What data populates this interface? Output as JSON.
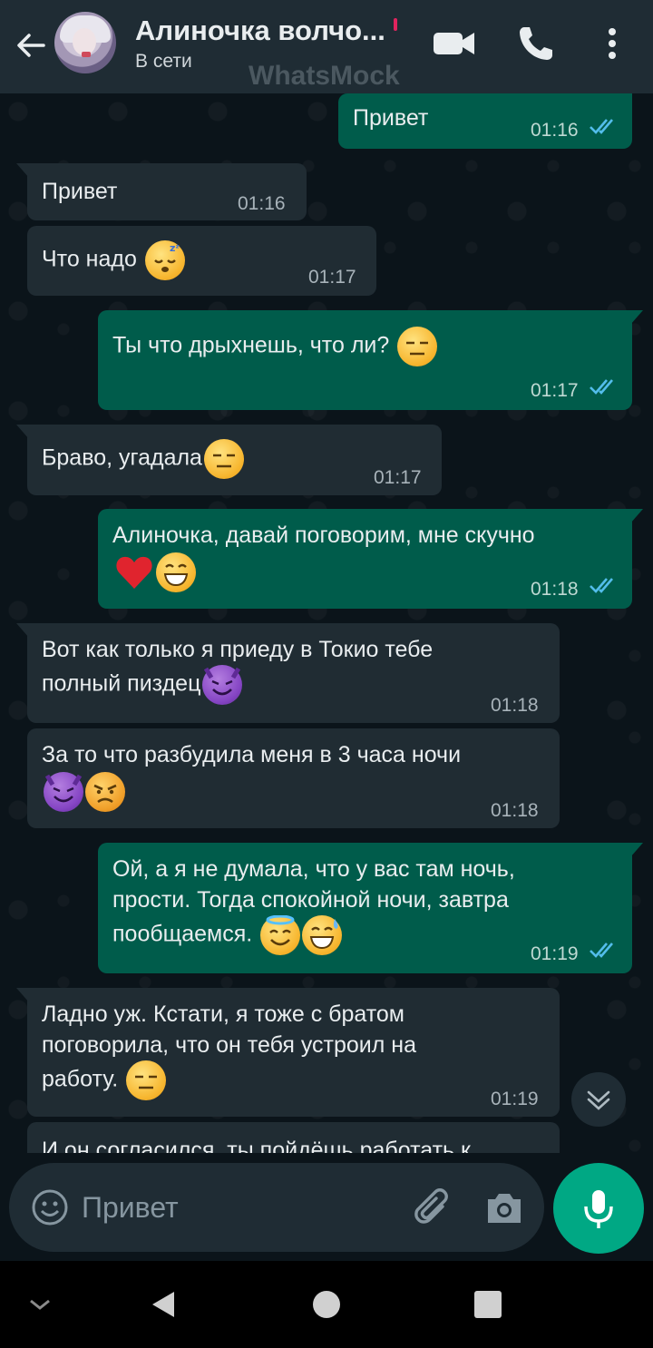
{
  "header": {
    "contact_name": "Алиночка волчо...",
    "status": "В сети",
    "watermark": "WhatsMock",
    "icons": [
      "back-arrow-icon",
      "video-call-icon",
      "phone-call-icon",
      "more-vert-icon"
    ]
  },
  "messages": [
    {
      "dir": "out",
      "text": "Привет",
      "time": "01:16",
      "read": true
    },
    {
      "dir": "in",
      "text": "Привет",
      "time": "01:16"
    },
    {
      "dir": "in",
      "text": "Что надо",
      "emoji": [
        "sleeping"
      ],
      "time": "01:17"
    },
    {
      "dir": "out",
      "text": "Ты что дрыхнешь, что ли?",
      "emoji": [
        "expressionless"
      ],
      "time": "01:17",
      "read": true
    },
    {
      "dir": "in",
      "text": "Браво, угадала",
      "emoji": [
        "expressionless"
      ],
      "time": "01:17"
    },
    {
      "dir": "out",
      "text": "Алиночка, давай поговорим, мне скучно",
      "emoji": [
        "red-heart",
        "grinning"
      ],
      "time": "01:18",
      "read": true
    },
    {
      "dir": "in",
      "text_lines": [
        "Вот как только я приеду в Токио тебе",
        "полный пиздец"
      ],
      "emoji": [
        "smiling-imp"
      ],
      "time": "01:18"
    },
    {
      "dir": "in",
      "text": "За то что разбудила меня в 3 часа ночи",
      "emoji": [
        "smiling-imp",
        "angry"
      ],
      "time": "01:18"
    },
    {
      "dir": "out",
      "text_lines": [
        "Ой, а я не думала, что у вас там ночь,",
        "прости. Тогда спокойной ночи, завтра",
        "пообщаемся."
      ],
      "emoji": [
        "halo",
        "sweat-smile"
      ],
      "time": "01:19",
      "read": true
    },
    {
      "dir": "in",
      "text_lines": [
        "Ладно уж. Кстати, я тоже с братом",
        "поговорила, что он тебя устроил на",
        "работу."
      ],
      "emoji": [
        "expressionless"
      ],
      "time": "01:19"
    },
    {
      "dir": "in",
      "text": "И он согласился, ты пойдёшь работать к",
      "partial": true
    }
  ],
  "composer": {
    "placeholder": "Привет",
    "icons": [
      "emoji-icon",
      "attach-icon",
      "camera-icon",
      "mic-icon"
    ]
  },
  "colors": {
    "background": "#0b141a",
    "header": "#1f2c34",
    "incoming_bubble": "#202c33",
    "outgoing_bubble": "#005c4b",
    "accent": "#00a884",
    "read_ticks": "#53bdeb"
  }
}
